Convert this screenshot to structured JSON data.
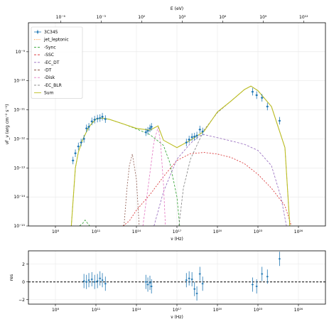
{
  "chart_data": [
    {
      "type": "line",
      "xscale": "log",
      "yscale": "log",
      "xlim": [
        1000000.0,
        1e+28
      ],
      "ylim": [
        1e-15,
        1e-08
      ],
      "xlabel": "ν (Hz)",
      "ylabel": "νF_ν (erg cm⁻² s⁻¹)",
      "top_xlabel": "E (eV)",
      "x_ticks": [
        {
          "v": 100000000.0,
          "label": "10⁸"
        },
        {
          "v": 100000000000.0,
          "label": "10¹¹"
        },
        {
          "v": 100000000000000.0,
          "label": "10¹⁴"
        },
        {
          "v": 1e+17,
          "label": "10¹⁷"
        },
        {
          "v": 1e+20,
          "label": "10²⁰"
        },
        {
          "v": 1e+23,
          "label": "10²³"
        },
        {
          "v": 1e+26,
          "label": "10²⁶"
        }
      ],
      "top_ticks": [
        {
          "v": 1e-06,
          "label": "10⁻⁶"
        },
        {
          "v": 0.001,
          "label": "10⁻³"
        },
        {
          "v": 1,
          "label": "10⁰"
        },
        {
          "v": 1000.0,
          "label": "10³"
        },
        {
          "v": 1000000.0,
          "label": "10⁶"
        },
        {
          "v": 1000000000.0,
          "label": "10⁹"
        },
        {
          "v": 1000000000000.0,
          "label": "10¹²"
        }
      ],
      "y_ticks": [
        {
          "v": 1e-15,
          "label": "10⁻¹⁵"
        },
        {
          "v": 1e-14,
          "label": "10⁻¹⁴"
        },
        {
          "v": 1e-13,
          "label": "10⁻¹³"
        },
        {
          "v": 1e-12,
          "label": "10⁻¹²"
        },
        {
          "v": 1e-11,
          "label": "10⁻¹¹"
        },
        {
          "v": 1e-10,
          "label": "10⁻¹⁰"
        },
        {
          "v": 1e-09,
          "label": "10⁻⁹"
        }
      ],
      "grid": true,
      "legend_position": "top-left",
      "legend": [
        {
          "name": "3C345",
          "color": "#1f77b4",
          "style": "errorbar"
        },
        {
          "name": "jet_leptonic",
          "color": "#ff7f0e",
          "style": "dotted"
        },
        {
          "name": "-Sync",
          "color": "#2ca02c",
          "style": "dashed"
        },
        {
          "name": "-SSC",
          "color": "#d62728",
          "style": "dashed"
        },
        {
          "name": "-EC_DT",
          "color": "#9467bd",
          "style": "dashed"
        },
        {
          "name": "-DT",
          "color": "#8c564b",
          "style": "dashed"
        },
        {
          "name": "-Disk",
          "color": "#e377c2",
          "style": "dashed"
        },
        {
          "name": "-EC_BLR",
          "color": "#7f7f7f",
          "style": "dashed"
        },
        {
          "name": "Sum",
          "color": "#bcbd22",
          "style": "solid"
        }
      ],
      "data_points": [
        {
          "x": 2000000000.0,
          "y": 1.8e-13
        },
        {
          "x": 3000000000.0,
          "y": 3.2e-13
        },
        {
          "x": 5000000000.0,
          "y": 5.5e-13
        },
        {
          "x": 8000000000.0,
          "y": 7.5e-13
        },
        {
          "x": 13000000000.0,
          "y": 1e-12
        },
        {
          "x": 20000000000.0,
          "y": 2.3e-12
        },
        {
          "x": 30000000000.0,
          "y": 2.6e-12
        },
        {
          "x": 50000000000.0,
          "y": 4e-12
        },
        {
          "x": 80000000000.0,
          "y": 4.6e-12
        },
        {
          "x": 130000000000.0,
          "y": 5e-12
        },
        {
          "x": 200000000000.0,
          "y": 5.2e-12
        },
        {
          "x": 300000000000.0,
          "y": 5.8e-12
        },
        {
          "x": 500000000000.0,
          "y": 4.8e-12
        },
        {
          "x": 500000000000000.0,
          "y": 1.7e-12
        },
        {
          "x": 700000000000000.0,
          "y": 1.9e-12
        },
        {
          "x": 1000000000000000.0,
          "y": 2.3e-12
        },
        {
          "x": 1300000000000000.0,
          "y": 2.6e-12
        },
        {
          "x": 5e+17,
          "y": 7.5e-13
        },
        {
          "x": 8e+17,
          "y": 9.5e-13
        },
        {
          "x": 1.3e+18,
          "y": 1.15e-12
        },
        {
          "x": 2e+18,
          "y": 1.2e-12
        },
        {
          "x": 3e+18,
          "y": 1.3e-12
        },
        {
          "x": 5e+18,
          "y": 2.1e-12
        },
        {
          "x": 8e+18,
          "y": 1.8e-12
        },
        {
          "x": 4e+22,
          "y": 4.2e-11
        },
        {
          "x": 8e+22,
          "y": 3.2e-11
        },
        {
          "x": 2e+23,
          "y": 2.6e-11
        },
        {
          "x": 5e+23,
          "y": 1.3e-11
        },
        {
          "x": 4e+24,
          "y": 4.2e-12
        }
      ],
      "curves": [
        {
          "name": "Sync",
          "color": "#2ca02c",
          "dash": "3,2",
          "points": [
            [
              1500000000.0,
              1e-15
            ],
            [
              3000000000.0,
              1e-13
            ],
            [
              5000000000.0,
              3.5e-13
            ],
            [
              10000000000.0,
              9e-13
            ],
            [
              30000000000.0,
              2.6e-12
            ],
            [
              100000000000.0,
              4.8e-12
            ],
            [
              300000000000.0,
              5.2e-12
            ],
            [
              1000000000000.0,
              4.7e-12
            ],
            [
              10000000000000.0,
              3.3e-12
            ],
            [
              100000000000000.0,
              2.2e-12
            ],
            [
              1000000000000000.0,
              1.4e-12
            ],
            [
              1e+16,
              6e-13
            ],
            [
              3e+16,
              1.5e-13
            ],
            [
              1e+17,
              1e-14
            ],
            [
              1.6e+17,
              1e-15
            ]
          ]
        },
        {
          "name": "Sync_sa_bump",
          "color": "#2ca02c",
          "dash": "3,2",
          "points": [
            [
              6000000000.0,
              1e-15
            ],
            [
              10000000000.0,
              1.2e-15
            ],
            [
              16000000000.0,
              1.6e-15
            ],
            [
              25000000000.0,
              1.2e-15
            ],
            [
              35000000000.0,
              1e-15
            ]
          ]
        },
        {
          "name": "SSC",
          "color": "#d62728",
          "dash": "2,2",
          "points": [
            [
              10000000000000.0,
              1e-15
            ],
            [
              30000000000000.0,
              1.5e-15
            ],
            [
              100000000000000.0,
              3.5e-15
            ],
            [
              1000000000000000.0,
              1.2e-14
            ],
            [
              1e+16,
              5e-14
            ],
            [
              1e+17,
              1.8e-13
            ],
            [
              1e+18,
              3.1e-13
            ],
            [
              1e+19,
              3.4e-13
            ],
            [
              1e+20,
              3e-13
            ],
            [
              1e+21,
              2.3e-13
            ],
            [
              1e+22,
              1.4e-13
            ],
            [
              1e+23,
              6e-14
            ],
            [
              1e+24,
              2e-14
            ],
            [
              1e+25,
              5e-15
            ],
            [
              3e+25,
              1e-15
            ]
          ]
        },
        {
          "name": "EC_DT",
          "color": "#9467bd",
          "dash": "3,2",
          "points": [
            [
              2000000000000000.0,
              1e-15
            ],
            [
              1e+16,
              1.5e-14
            ],
            [
              1e+17,
              2e-13
            ],
            [
              1e+18,
              7e-13
            ],
            [
              5e+18,
              1.3e-12
            ],
            [
              1e+19,
              1.4e-12
            ],
            [
              1e+20,
              1.1e-12
            ],
            [
              1e+21,
              8.5e-13
            ],
            [
              1e+22,
              6.5e-13
            ],
            [
              1e+23,
              4e-13
            ],
            [
              1e+24,
              1.2e-13
            ],
            [
              5e+24,
              1e-14
            ],
            [
              1.3e+25,
              1e-15
            ]
          ]
        },
        {
          "name": "DT",
          "color": "#8c564b",
          "dash": "2,2",
          "points": [
            [
              12000000000000.0,
              1e-15
            ],
            [
              20000000000000.0,
              2e-14
            ],
            [
              30000000000000.0,
              1.2e-13
            ],
            [
              50000000000000.0,
              3e-13
            ],
            [
              100000000000000.0,
              4e-14
            ],
            [
              160000000000000.0,
              1e-15
            ]
          ]
        },
        {
          "name": "Disk",
          "color": "#e377c2",
          "dash": "3,2",
          "points": [
            [
              300000000000000.0,
              1e-15
            ],
            [
              800000000000000.0,
              3e-14
            ],
            [
              2000000000000000.0,
              8e-13
            ],
            [
              4000000000000000.0,
              2.5e-12
            ],
            [
              6000000000000000.0,
              8e-13
            ],
            [
              1e+16,
              3e-14
            ],
            [
              1.4e+16,
              1e-15
            ]
          ]
        },
        {
          "name": "EC_BLR",
          "color": "#7f7f7f",
          "dash": "3,2",
          "points": [
            [
              1.4e+17,
              1e-15
            ],
            [
              3e+17,
              2e-14
            ],
            [
              1e+18,
              2e-13
            ],
            [
              5e+18,
              1e-12
            ],
            [
              1e+19,
              2e-12
            ],
            [
              1e+20,
              8e-12
            ],
            [
              1e+21,
              2e-11
            ],
            [
              1e+22,
              5e-11
            ],
            [
              3e+22,
              6.5e-11
            ],
            [
              1e+23,
              4.5e-11
            ],
            [
              1e+24,
              1.3e-11
            ],
            [
              1e+25,
              5e-13
            ],
            [
              2.3e+25,
              1e-15
            ]
          ]
        },
        {
          "name": "Sum",
          "color": "#bcbd22",
          "dash": "",
          "points": [
            [
              1500000000.0,
              1e-15
            ],
            [
              3000000000.0,
              1e-13
            ],
            [
              5000000000.0,
              3.5e-13
            ],
            [
              10000000000.0,
              9e-13
            ],
            [
              30000000000.0,
              2.6e-12
            ],
            [
              100000000000.0,
              4.8e-12
            ],
            [
              300000000000.0,
              5.2e-12
            ],
            [
              1000000000000.0,
              4.7e-12
            ],
            [
              10000000000000.0,
              3.3e-12
            ],
            [
              100000000000000.0,
              2.3e-12
            ],
            [
              1000000000000000.0,
              2e-12
            ],
            [
              4000000000000000.0,
              2.8e-12
            ],
            [
              1e+16,
              9e-13
            ],
            [
              1e+17,
              5e-13
            ],
            [
              1e+18,
              9e-13
            ],
            [
              1e+19,
              1.8e-12
            ],
            [
              1e+20,
              8.5e-12
            ],
            [
              1e+21,
              2e-11
            ],
            [
              1e+22,
              5e-11
            ],
            [
              3e+22,
              6.6e-11
            ],
            [
              1e+23,
              4.6e-11
            ],
            [
              1e+24,
              1.3e-11
            ],
            [
              1e+25,
              5e-13
            ],
            [
              2.3e+25,
              1e-15
            ]
          ]
        }
      ]
    },
    {
      "type": "scatter",
      "xscale": "log",
      "xlim": [
        1000000.0,
        1e+28
      ],
      "ylim": [
        -2.5,
        3.5
      ],
      "xlabel": "ν (Hz)",
      "ylabel": "res",
      "y_ticks": [
        {
          "v": -2,
          "label": "−2"
        },
        {
          "v": 0,
          "label": "0"
        },
        {
          "v": 2,
          "label": "2"
        }
      ],
      "x_ticks": [
        {
          "v": 100000000.0,
          "label": "10⁸"
        },
        {
          "v": 100000000000.0,
          "label": "10¹¹"
        },
        {
          "v": 100000000000000.0,
          "label": "10¹⁴"
        },
        {
          "v": 1e+17,
          "label": "10¹⁷"
        },
        {
          "v": 1e+20,
          "label": "10²⁰"
        },
        {
          "v": 1e+23,
          "label": "10²³"
        },
        {
          "v": 1e+26,
          "label": "10²⁶"
        }
      ],
      "residuals": [
        {
          "x": 13000000000.0,
          "y": 0.1
        },
        {
          "x": 20000000000.0,
          "y": 0.0
        },
        {
          "x": 30000000000.0,
          "y": 0.2
        },
        {
          "x": 50000000000.0,
          "y": 0.3
        },
        {
          "x": 80000000000.0,
          "y": 0.0
        },
        {
          "x": 130000000000.0,
          "y": 0.1
        },
        {
          "x": 200000000000.0,
          "y": 0.4
        },
        {
          "x": 300000000000.0,
          "y": 0.2
        },
        {
          "x": 500000000000.0,
          "y": -0.2
        },
        {
          "x": 500000000000000.0,
          "y": 0.0
        },
        {
          "x": 700000000000000.0,
          "y": -0.3
        },
        {
          "x": 1000000000000000.0,
          "y": -0.1
        },
        {
          "x": 1300000000000000.0,
          "y": -0.5
        },
        {
          "x": 5e+17,
          "y": 0.2
        },
        {
          "x": 8e+17,
          "y": 0.4
        },
        {
          "x": 1.3e+18,
          "y": 0.3
        },
        {
          "x": 2e+18,
          "y": -0.8
        },
        {
          "x": 3e+18,
          "y": -1.3
        },
        {
          "x": 5e+18,
          "y": 0.9
        },
        {
          "x": 8e+18,
          "y": -0.2
        },
        {
          "x": 4e+22,
          "y": -0.3
        },
        {
          "x": 8e+22,
          "y": -0.5
        },
        {
          "x": 2e+23,
          "y": 0.9
        },
        {
          "x": 5e+23,
          "y": 0.6
        },
        {
          "x": 4e+24,
          "y": 2.6
        }
      ]
    }
  ]
}
